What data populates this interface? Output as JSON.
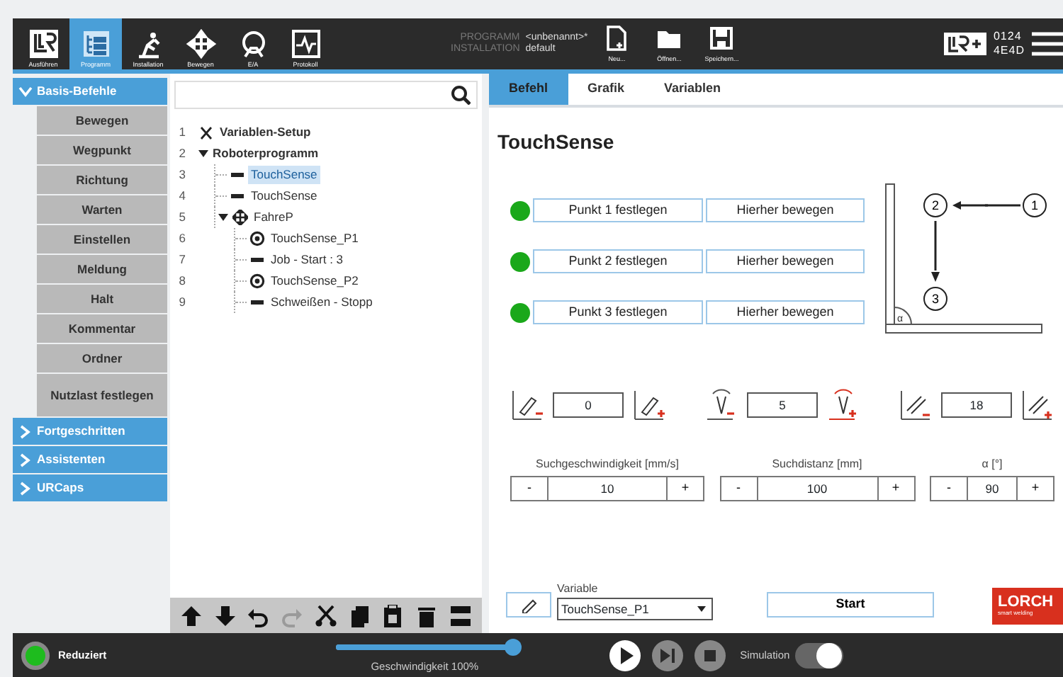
{
  "header": {
    "nav": [
      {
        "label": "Ausführen",
        "kind": "run",
        "selected": false
      },
      {
        "label": "Programm",
        "kind": "program",
        "selected": true
      },
      {
        "label": "Installation",
        "kind": "installation",
        "selected": false
      },
      {
        "label": "Bewegen",
        "kind": "move",
        "selected": false
      },
      {
        "label": "E/A",
        "kind": "io",
        "selected": false
      },
      {
        "label": "Protokoll",
        "kind": "log",
        "selected": false
      }
    ],
    "program_label": "PROGRAMM",
    "program_name": "<unbenannt>*",
    "installation_label": "INSTALLATION",
    "installation_name": "default",
    "file_buttons": [
      {
        "label": "Neu...",
        "kind": "new"
      },
      {
        "label": "Öffnen...",
        "kind": "open"
      },
      {
        "label": "Speichern...",
        "kind": "save"
      }
    ],
    "serial": [
      "0124",
      "4E4D"
    ]
  },
  "sidebar": [
    {
      "label": "Basis-Befehle",
      "expanded": true,
      "items": [
        "Bewegen",
        "Wegpunkt",
        "Richtung",
        "Warten",
        "Einstellen",
        "Meldung",
        "Halt",
        "Kommentar",
        "Ordner",
        "Nutzlast festlegen"
      ]
    },
    {
      "label": "Fortgeschritten",
      "expanded": false
    },
    {
      "label": "Assistenten",
      "expanded": false
    },
    {
      "label": "URCaps",
      "expanded": false
    }
  ],
  "tree": [
    {
      "line": "1",
      "kind": "variables",
      "label": "Variablen-Setup",
      "selected": false
    },
    {
      "line": "2",
      "kind": "program",
      "label": "Roboterprogramm",
      "selected": false,
      "expanded": true,
      "children": [
        {
          "line": "3",
          "kind": "command",
          "label": "TouchSense",
          "selected": true
        },
        {
          "line": "4",
          "kind": "command",
          "label": "TouchSense",
          "selected": false
        },
        {
          "line": "5",
          "kind": "move",
          "label": "FahreP",
          "selected": false,
          "expanded": true,
          "children": [
            {
              "line": "6",
              "kind": "waypoint",
              "label": "TouchSense_P1",
              "selected": false
            },
            {
              "line": "7",
              "kind": "command",
              "label": "Job - Start : 3",
              "selected": false
            },
            {
              "line": "8",
              "kind": "waypoint",
              "label": "TouchSense_P2",
              "selected": false
            },
            {
              "line": "9",
              "kind": "command",
              "label": "Schweißen - Stopp",
              "selected": false
            }
          ]
        }
      ]
    }
  ],
  "tree_toolbar": [
    {
      "kind": "up",
      "disabled": false
    },
    {
      "kind": "down",
      "disabled": false
    },
    {
      "kind": "undo",
      "disabled": false
    },
    {
      "kind": "redo",
      "disabled": true
    },
    {
      "kind": "cut",
      "disabled": false
    },
    {
      "kind": "copy",
      "disabled": false
    },
    {
      "kind": "paste",
      "disabled": false
    },
    {
      "kind": "delete",
      "disabled": false
    },
    {
      "kind": "suppress",
      "disabled": false
    }
  ],
  "tabs": [
    {
      "label": "Befehl",
      "selected": true
    },
    {
      "label": "Grafik",
      "selected": false
    },
    {
      "label": "Variablen",
      "selected": false
    }
  ],
  "title": "TouchSense",
  "points": [
    {
      "set": true,
      "set_label": "Punkt 1 festlegen",
      "move_label": "Hierher bewegen"
    },
    {
      "set": true,
      "set_label": "Punkt 2 festlegen",
      "move_label": "Hierher bewegen"
    },
    {
      "set": true,
      "set_label": "Punkt 3 festlegen",
      "move_label": "Hierher bewegen"
    }
  ],
  "diagram": {
    "labels": [
      "1",
      "2",
      "3"
    ],
    "angle": "α"
  },
  "parameters": [
    {
      "kind": "offset",
      "value": "0"
    },
    {
      "kind": "weave",
      "value": "5"
    },
    {
      "kind": "angle",
      "value": "18"
    }
  ],
  "steppers": [
    {
      "label": "Suchgeschwindigkeit [mm/s]",
      "value": "10",
      "decrement": "-",
      "increment": "+"
    },
    {
      "label": "Suchdistanz [mm]",
      "value": "100",
      "decrement": "-",
      "increment": "+"
    },
    {
      "label": "α [°]",
      "value": "90",
      "decrement": "-",
      "increment": "+"
    }
  ],
  "variable": {
    "label": "Variable",
    "value": "TouchSense_P1"
  },
  "start_button": "Start",
  "logo": {
    "name": "LORCH",
    "tagline": "smart welding"
  },
  "footer": {
    "mode": "Reduziert",
    "level": 1.0,
    "speed_label": "Geschwindigkeit 100%",
    "simulation_label": "Simulation",
    "simulation_on": true
  }
}
